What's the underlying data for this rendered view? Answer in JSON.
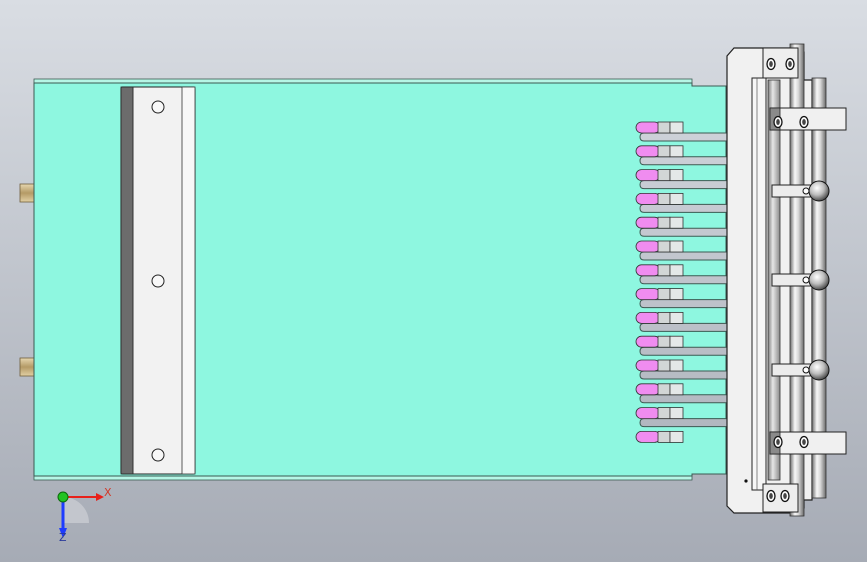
{
  "triad": {
    "x_label": "X",
    "z_label": "Z",
    "x_color": "#e8201a",
    "z_color": "#1e3cff",
    "origin_color": "#22c322"
  },
  "colors": {
    "background_top": "#d9dde3",
    "background_bottom": "#a6abb5",
    "plate_fill": "#8ef7e0",
    "plate_edge": "#3c5a52",
    "finger_tip": "#f08cf0",
    "finger_block": "#d2d6d6",
    "bracket_fill": "#f0f0f0",
    "rod_light": "#f4f4f4",
    "rod_dark": "#7a7a7a",
    "connector": "#c9b48a"
  },
  "fingers": {
    "count": 14
  },
  "bar_holes": {
    "count": 3
  },
  "clamps": {
    "count": 3
  }
}
